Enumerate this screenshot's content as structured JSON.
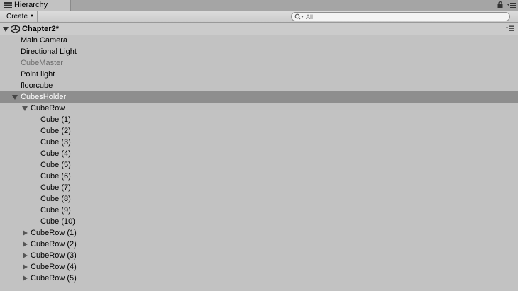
{
  "panel": {
    "tab_label": "Hierarchy",
    "tab_icon": "list-icon",
    "lock_icon": "lock-icon",
    "menu_icon": "panel-menu-icon"
  },
  "toolbar": {
    "create_label": "Create",
    "search_placeholder": "All"
  },
  "scene": {
    "name": "Chapter2*",
    "icon": "unity-logo-icon"
  },
  "items": [
    {
      "label": "Main Camera",
      "depth": 0,
      "expander": "none",
      "dimmed": false,
      "selected": false
    },
    {
      "label": "Directional Light",
      "depth": 0,
      "expander": "none",
      "dimmed": false,
      "selected": false
    },
    {
      "label": "CubeMaster",
      "depth": 0,
      "expander": "none",
      "dimmed": true,
      "selected": false
    },
    {
      "label": "Point light",
      "depth": 0,
      "expander": "none",
      "dimmed": false,
      "selected": false
    },
    {
      "label": "floorcube",
      "depth": 0,
      "expander": "none",
      "dimmed": false,
      "selected": false
    },
    {
      "label": "CubesHolder",
      "depth": 0,
      "expander": "expanded",
      "dimmed": false,
      "selected": true
    },
    {
      "label": "CubeRow",
      "depth": 1,
      "expander": "expanded",
      "dimmed": false,
      "selected": false
    },
    {
      "label": "Cube (1)",
      "depth": 2,
      "expander": "none",
      "dimmed": false,
      "selected": false
    },
    {
      "label": "Cube (2)",
      "depth": 2,
      "expander": "none",
      "dimmed": false,
      "selected": false
    },
    {
      "label": "Cube (3)",
      "depth": 2,
      "expander": "none",
      "dimmed": false,
      "selected": false
    },
    {
      "label": "Cube (4)",
      "depth": 2,
      "expander": "none",
      "dimmed": false,
      "selected": false
    },
    {
      "label": "Cube (5)",
      "depth": 2,
      "expander": "none",
      "dimmed": false,
      "selected": false
    },
    {
      "label": "Cube (6)",
      "depth": 2,
      "expander": "none",
      "dimmed": false,
      "selected": false
    },
    {
      "label": "Cube (7)",
      "depth": 2,
      "expander": "none",
      "dimmed": false,
      "selected": false
    },
    {
      "label": "Cube (8)",
      "depth": 2,
      "expander": "none",
      "dimmed": false,
      "selected": false
    },
    {
      "label": "Cube (9)",
      "depth": 2,
      "expander": "none",
      "dimmed": false,
      "selected": false
    },
    {
      "label": "Cube (10)",
      "depth": 2,
      "expander": "none",
      "dimmed": false,
      "selected": false
    },
    {
      "label": "CubeRow (1)",
      "depth": 1,
      "expander": "collapsed",
      "dimmed": false,
      "selected": false
    },
    {
      "label": "CubeRow (2)",
      "depth": 1,
      "expander": "collapsed",
      "dimmed": false,
      "selected": false
    },
    {
      "label": "CubeRow (3)",
      "depth": 1,
      "expander": "collapsed",
      "dimmed": false,
      "selected": false
    },
    {
      "label": "CubeRow (4)",
      "depth": 1,
      "expander": "collapsed",
      "dimmed": false,
      "selected": false
    },
    {
      "label": "CubeRow (5)",
      "depth": 1,
      "expander": "collapsed",
      "dimmed": false,
      "selected": false
    }
  ],
  "colors": {
    "background": "#c2c2c2",
    "selection": "#8e8e8e",
    "dimmed_text": "#6e6e6e"
  }
}
